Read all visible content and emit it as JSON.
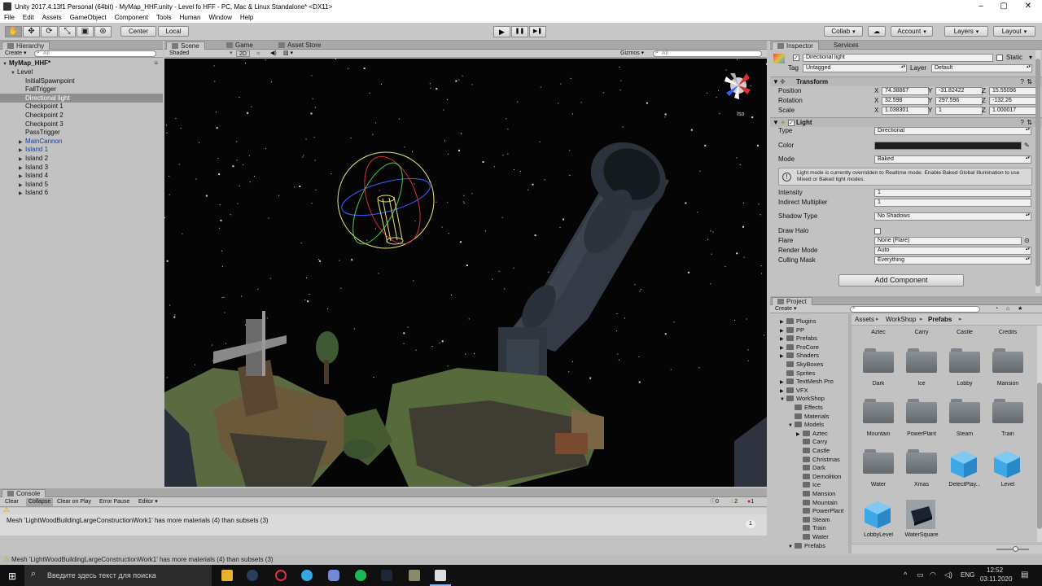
{
  "window": {
    "title": "Unity 2017.4.13f1 Personal (64bit) - MyMap_HHF.unity - Level fo HFF - PC, Mac & Linux Standalone* <DX11>",
    "minimize": "–",
    "maximize": "▢",
    "close": "✕"
  },
  "menu": [
    "File",
    "Edit",
    "Assets",
    "GameObject",
    "Component",
    "Tools",
    "Human",
    "Window",
    "Help"
  ],
  "toolbar": {
    "pivot": "Center",
    "space": "Local",
    "play": "▶",
    "pause": "❚❚",
    "step": "▶❚",
    "collab": "Collab",
    "cloud": "☁",
    "account": "Account",
    "layers": "Layers",
    "layout": "Layout"
  },
  "hierarchy": {
    "tab": "Hierarchy",
    "create": "Create",
    "search": "All",
    "scene_name": "MyMap_HHF*",
    "items": [
      {
        "label": "Level",
        "depth": 1,
        "arrow": "▼",
        "style": ""
      },
      {
        "label": "InitialSpawnpoint",
        "depth": 2,
        "arrow": "",
        "style": ""
      },
      {
        "label": "FallTrigger",
        "depth": 2,
        "arrow": "",
        "style": ""
      },
      {
        "label": "Directional light",
        "depth": 2,
        "arrow": "",
        "style": "sel"
      },
      {
        "label": "Checkpoint 1",
        "depth": 2,
        "arrow": "",
        "style": ""
      },
      {
        "label": "Checkpoint 2",
        "depth": 2,
        "arrow": "",
        "style": ""
      },
      {
        "label": "Checkpoint 3",
        "depth": 2,
        "arrow": "",
        "style": ""
      },
      {
        "label": "PassTrigger",
        "depth": 2,
        "arrow": "",
        "style": ""
      },
      {
        "label": "MainCannon",
        "depth": 2,
        "arrow": "▶",
        "style": "blue"
      },
      {
        "label": "Island 1",
        "depth": 2,
        "arrow": "▶",
        "style": "blue"
      },
      {
        "label": "Island 2",
        "depth": 2,
        "arrow": "▶",
        "style": ""
      },
      {
        "label": "Island 3",
        "depth": 2,
        "arrow": "▶",
        "style": ""
      },
      {
        "label": "Island 4",
        "depth": 2,
        "arrow": "▶",
        "style": ""
      },
      {
        "label": "Island 5",
        "depth": 2,
        "arrow": "▶",
        "style": ""
      },
      {
        "label": "Island 6",
        "depth": 2,
        "arrow": "▶",
        "style": ""
      }
    ]
  },
  "scene": {
    "tabs": [
      "Scene",
      "Game",
      "Asset Store"
    ],
    "shading": "Shaded",
    "mode2d": "2D",
    "gizmos": "Gizmos",
    "search": "All",
    "iso": "Iso"
  },
  "inspector": {
    "tabs": [
      "Inspector",
      "Services"
    ],
    "object_name": "Directional light",
    "static": "Static",
    "tag_label": "Tag",
    "tag": "Untagged",
    "layer_label": "Layer",
    "layer": "Default",
    "transform": {
      "title": "Transform",
      "position_label": "Position",
      "rotation_label": "Rotation",
      "scale_label": "Scale",
      "position": {
        "x": "74.38867",
        "y": "-31.82422",
        "z": "15.55096"
      },
      "rotation": {
        "x": "32.598",
        "y": "297.596",
        "z": "-132.26"
      },
      "scale": {
        "x": "1.038301",
        "y": "1",
        "z": "1.000017"
      }
    },
    "light": {
      "title": "Light",
      "type_label": "Type",
      "type": "Directional",
      "color_label": "Color",
      "mode_label": "Mode",
      "mode": "Baked",
      "info": "Light mode is currently overridden to Realtime mode. Enable Baked Global Illumination to use Mixed or Baked light modes.",
      "intensity_label": "Intensity",
      "intensity": "1",
      "indirect_label": "Indirect Multiplier",
      "indirect": "1",
      "shadow_label": "Shadow Type",
      "shadow": "No Shadows",
      "halo_label": "Draw Halo",
      "flare_label": "Flare",
      "flare": "None (Flare)",
      "render_label": "Render Mode",
      "render": "Auto",
      "culling_label": "Culling Mask",
      "culling": "Everything"
    },
    "add_component": "Add Component"
  },
  "project": {
    "tab": "Project",
    "create": "Create",
    "breadcrumb": [
      "Assets",
      "WorkShop",
      "Prefabs"
    ],
    "tree": [
      {
        "label": "Plugins",
        "depth": 1,
        "arrow": "▶"
      },
      {
        "label": "PP",
        "depth": 1,
        "arrow": "▶"
      },
      {
        "label": "Prefabs",
        "depth": 1,
        "arrow": "▶"
      },
      {
        "label": "ProCore",
        "depth": 1,
        "arrow": "▶"
      },
      {
        "label": "Shaders",
        "depth": 1,
        "arrow": "▶"
      },
      {
        "label": "SkyBoxes",
        "depth": 1,
        "arrow": ""
      },
      {
        "label": "Sprites",
        "depth": 1,
        "arrow": ""
      },
      {
        "label": "TextMesh Pro",
        "depth": 1,
        "arrow": "▶"
      },
      {
        "label": "VFX",
        "depth": 1,
        "arrow": "▶"
      },
      {
        "label": "WorkShop",
        "depth": 1,
        "arrow": "▼"
      },
      {
        "label": "Effects",
        "depth": 2,
        "arrow": ""
      },
      {
        "label": "Materials",
        "depth": 2,
        "arrow": ""
      },
      {
        "label": "Models",
        "depth": 2,
        "arrow": "▼"
      },
      {
        "label": "Aztec",
        "depth": 3,
        "arrow": "▶"
      },
      {
        "label": "Carry",
        "depth": 3,
        "arrow": ""
      },
      {
        "label": "Castle",
        "depth": 3,
        "arrow": ""
      },
      {
        "label": "Christmas",
        "depth": 3,
        "arrow": ""
      },
      {
        "label": "Dark",
        "depth": 3,
        "arrow": ""
      },
      {
        "label": "Demolition",
        "depth": 3,
        "arrow": ""
      },
      {
        "label": "Ice",
        "depth": 3,
        "arrow": ""
      },
      {
        "label": "Mansion",
        "depth": 3,
        "arrow": ""
      },
      {
        "label": "Mountain",
        "depth": 3,
        "arrow": ""
      },
      {
        "label": "PowerPlant",
        "depth": 3,
        "arrow": ""
      },
      {
        "label": "Steam",
        "depth": 3,
        "arrow": ""
      },
      {
        "label": "Train",
        "depth": 3,
        "arrow": ""
      },
      {
        "label": "Water",
        "depth": 3,
        "arrow": ""
      },
      {
        "label": "Prefabs",
        "depth": 2,
        "arrow": "▼"
      }
    ],
    "top_labels": [
      "Aztec",
      "Carry",
      "Castle",
      "Credits"
    ],
    "assets": [
      {
        "label": "Dark",
        "kind": "folder"
      },
      {
        "label": "Ice",
        "kind": "folder"
      },
      {
        "label": "Lobby",
        "kind": "folder"
      },
      {
        "label": "Mansion",
        "kind": "folder"
      },
      {
        "label": "Mountain",
        "kind": "folder"
      },
      {
        "label": "PowerPlant",
        "kind": "folder"
      },
      {
        "label": "Steam",
        "kind": "folder"
      },
      {
        "label": "Train",
        "kind": "folder"
      },
      {
        "label": "Water",
        "kind": "folder"
      },
      {
        "label": "Xmas",
        "kind": "folder"
      },
      {
        "label": "DetectPlay...",
        "kind": "prefab"
      },
      {
        "label": "Level",
        "kind": "prefab"
      },
      {
        "label": "LobbyLevel",
        "kind": "prefab"
      },
      {
        "label": "WaterSquare",
        "kind": "model"
      }
    ]
  },
  "console": {
    "tab": "Console",
    "buttons": [
      "Clear",
      "Collapse",
      "Clear on Play",
      "Error Pause",
      "Editor"
    ],
    "counts": {
      "log": "0",
      "warn": "2",
      "error": "1"
    },
    "message": "Mesh 'LightWoodBuildingLargeConstructionWork1' has more materials (4) than subsets (3)",
    "message_count": "1"
  },
  "statusbar": "Mesh 'LightWoodBuildingLargeConstructionWork1' has more materials (4) than subsets (3)",
  "taskbar": {
    "search_placeholder": "Введите здесь текст для поиска",
    "lang": "ENG",
    "time": "12:52",
    "date": "03.11.2020"
  },
  "colors": {
    "selection": "#8f8f8f",
    "prefab_blue": "#1a3e9c",
    "scene_bg": "#050505",
    "cube_blue": "#3ea7e6"
  }
}
